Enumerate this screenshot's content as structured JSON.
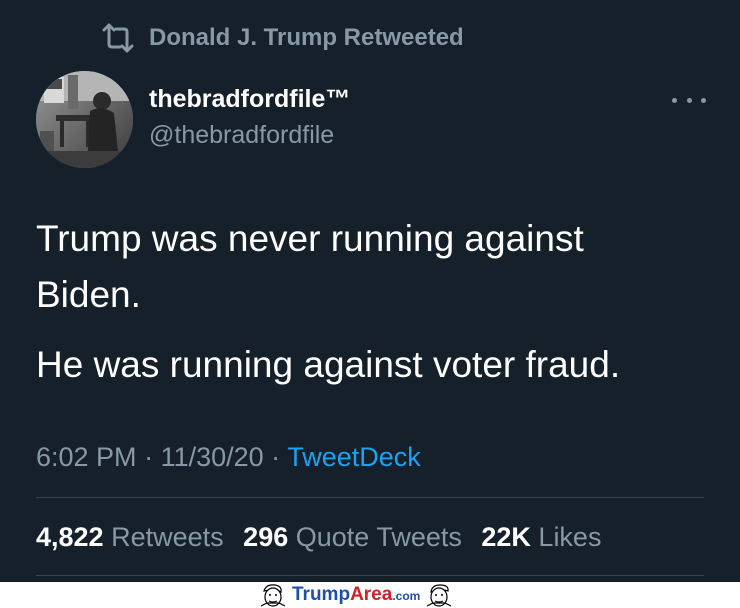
{
  "retweet": {
    "icon": "retweet-icon",
    "text": "Donald J. Trump Retweeted"
  },
  "author": {
    "display_name": "thebradfordfile™",
    "handle": "@thebradfordfile",
    "avatar": "avatar-photo"
  },
  "more_icon": "more-options-icon",
  "tweet": {
    "line1": "Trump was never running against Biden.",
    "line2": "He was running against voter fraud."
  },
  "meta": {
    "time": "6:02 PM",
    "sep1": " · ",
    "date": "11/30/20",
    "sep2": " · ",
    "source": "TweetDeck"
  },
  "stats": {
    "retweets_count": "4,822",
    "retweets_label": "Retweets",
    "quotes_count": "296",
    "quotes_label": "Quote Tweets",
    "likes_count": "22K",
    "likes_label": "Likes"
  },
  "watermark": {
    "part1": "Trump",
    "part2": "Area",
    "part3": ".com"
  },
  "colors": {
    "background": "#15202b",
    "secondary_text": "#8899a6",
    "link": "#1da1f2",
    "divider": "#38444d"
  }
}
